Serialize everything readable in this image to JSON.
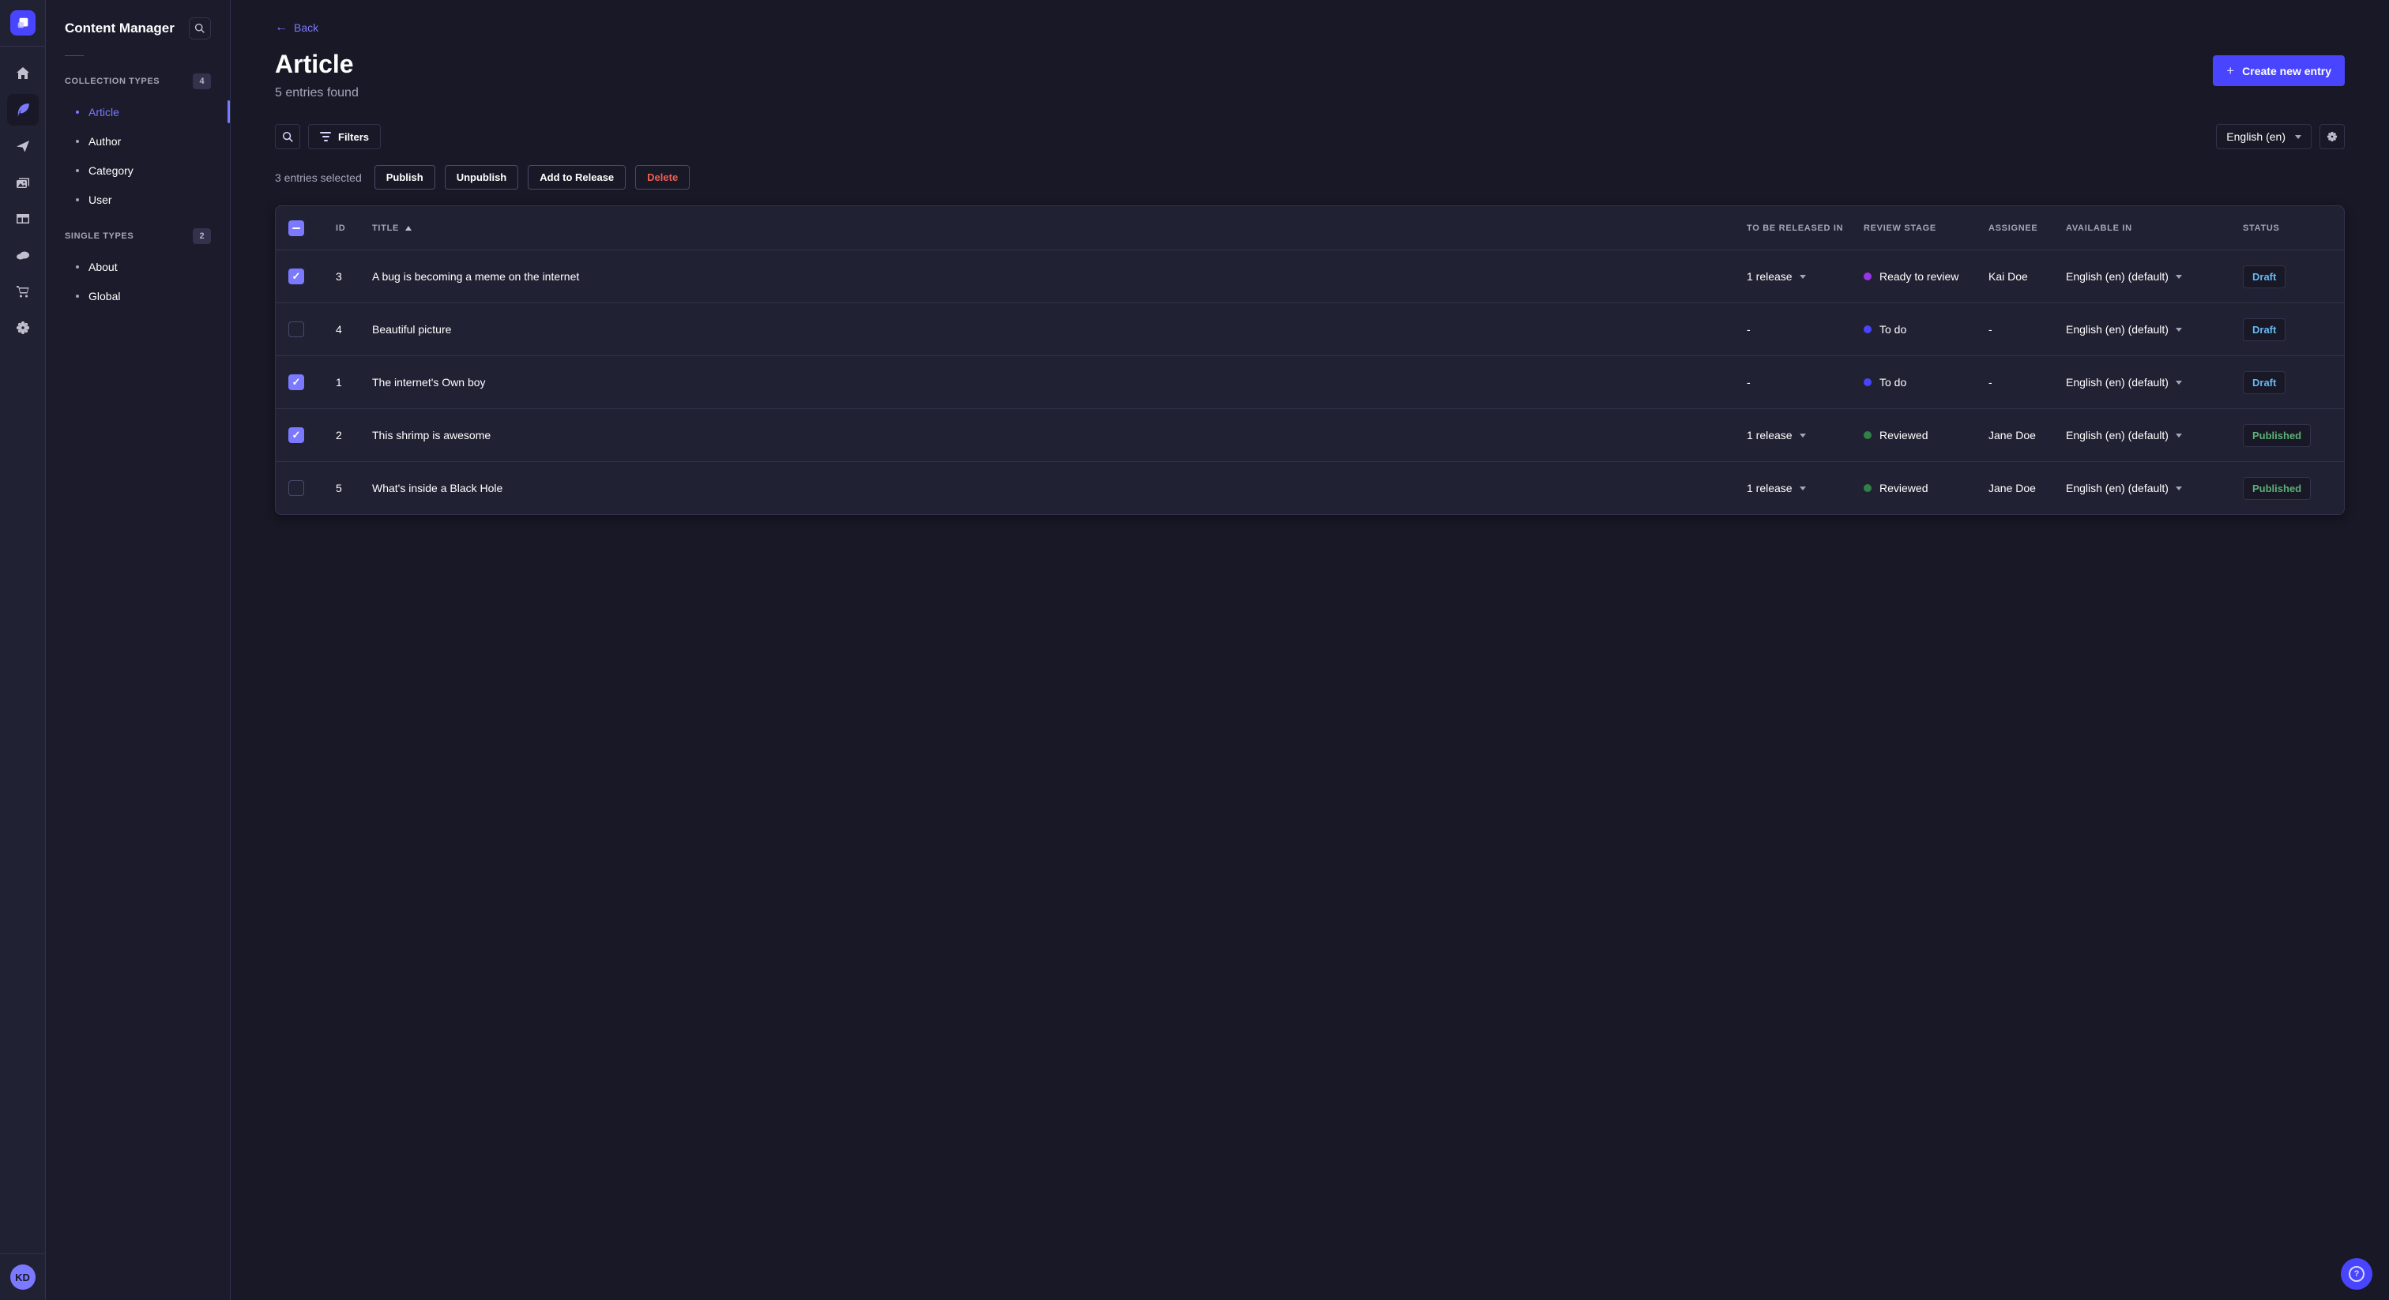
{
  "rail": {
    "icons": [
      "home-icon",
      "content-manager-feather-icon",
      "releases-send-icon",
      "media-library-icon",
      "content-type-builder-icon",
      "cloud-icon",
      "marketplace-cart-icon",
      "settings-gear-icon"
    ],
    "active_icon": "content-manager-feather-icon",
    "avatar_initials": "KD"
  },
  "subnav": {
    "title": "Content Manager",
    "sections": [
      {
        "label": "COLLECTION TYPES",
        "count": "4",
        "items": [
          {
            "label": "Article",
            "active": true
          },
          {
            "label": "Author",
            "active": false
          },
          {
            "label": "Category",
            "active": false
          },
          {
            "label": "User",
            "active": false
          }
        ]
      },
      {
        "label": "SINGLE TYPES",
        "count": "2",
        "items": [
          {
            "label": "About",
            "active": false
          },
          {
            "label": "Global",
            "active": false
          }
        ]
      }
    ]
  },
  "header": {
    "back_label": "Back",
    "back_arrow": "←",
    "title": "Article",
    "subtitle": "5 entries found",
    "create_label": "Create new entry",
    "plus": "+"
  },
  "toolbar": {
    "filters_label": "Filters",
    "locale_value": "English (en)"
  },
  "selection": {
    "text": "3 entries selected",
    "publish_label": "Publish",
    "unpublish_label": "Unpublish",
    "add_to_release_label": "Add to Release",
    "delete_label": "Delete"
  },
  "table": {
    "columns": {
      "id": "ID",
      "title": "TITLE",
      "released": "TO BE RELEASED IN",
      "review": "REVIEW STAGE",
      "assignee": "ASSIGNEE",
      "available": "AVAILABLE IN",
      "status": "STATUS"
    },
    "rows": [
      {
        "id": "3",
        "title": "A bug is becoming a meme on the internet",
        "release": "1 release",
        "stage": "Ready to review",
        "stage_color": "#9736e8",
        "assignee": "Kai Doe",
        "locale": "English (en) (default)",
        "status": "Draft",
        "status_color": "#66b7f1",
        "selected": true
      },
      {
        "id": "4",
        "title": "Beautiful picture",
        "release": "-",
        "stage": "To do",
        "stage_color": "#4945ff",
        "assignee": "-",
        "locale": "English (en) (default)",
        "status": "Draft",
        "status_color": "#66b7f1",
        "selected": false
      },
      {
        "id": "1",
        "title": "The internet's Own boy",
        "release": "-",
        "stage": "To do",
        "stage_color": "#4945ff",
        "assignee": "-",
        "locale": "English (en) (default)",
        "status": "Draft",
        "status_color": "#66b7f1",
        "selected": true
      },
      {
        "id": "2",
        "title": "This shrimp is awesome",
        "release": "1 release",
        "stage": "Reviewed",
        "stage_color": "#328048",
        "assignee": "Jane Doe",
        "locale": "English (en) (default)",
        "status": "Published",
        "status_color": "#5cb176",
        "selected": true
      },
      {
        "id": "5",
        "title": "What's inside a Black Hole",
        "release": "1 release",
        "stage": "Reviewed",
        "stage_color": "#328048",
        "assignee": "Jane Doe",
        "locale": "English (en) (default)",
        "status": "Published",
        "status_color": "#5cb176",
        "selected": false
      }
    ]
  },
  "colors": {
    "primary": "#4945ff",
    "primary_light": "#7b79ff",
    "draft_text": "#66b7f1",
    "published_text": "#5cb176",
    "danger_text": "#ee5e52"
  }
}
